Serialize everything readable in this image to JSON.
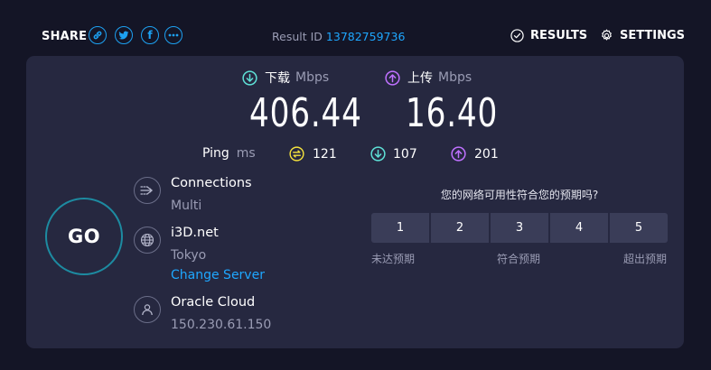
{
  "header": {
    "share_label": "SHARE",
    "share_buttons": [
      {
        "name": "link-icon",
        "glyph": ""
      },
      {
        "name": "twitter-icon",
        "glyph": ""
      },
      {
        "name": "facebook-icon",
        "glyph": "f"
      },
      {
        "name": "more-icon",
        "glyph": ""
      }
    ],
    "result_id_label": "Result ID",
    "result_id_value": "13782759736",
    "results_label": "RESULTS",
    "settings_label": "SETTINGS"
  },
  "download": {
    "label": "下载",
    "unit": "Mbps",
    "value": "406.44",
    "icon": "download-arrow-icon",
    "color": "#5ee0d6"
  },
  "upload": {
    "label": "上传",
    "unit": "Mbps",
    "value": "16.40",
    "icon": "upload-arrow-icon",
    "color": "#bf71ff"
  },
  "ping": {
    "label": "Ping",
    "unit": "ms",
    "idle": "121",
    "download": "107",
    "upload": "201",
    "idle_color": "#f5e23d"
  },
  "go_label": "GO",
  "connections": {
    "title": "Connections",
    "value": "Multi"
  },
  "server": {
    "title": "i3D.net",
    "location": "Tokyo",
    "change_label": "Change Server"
  },
  "isp": {
    "title": "Oracle Cloud",
    "ip": "150.230.61.150"
  },
  "survey": {
    "question": "您的网络可用性符合您的预期吗?",
    "options": [
      "1",
      "2",
      "3",
      "4",
      "5"
    ],
    "low_label": "未达预期",
    "mid_label": "符合预期",
    "high_label": "超出预期"
  }
}
